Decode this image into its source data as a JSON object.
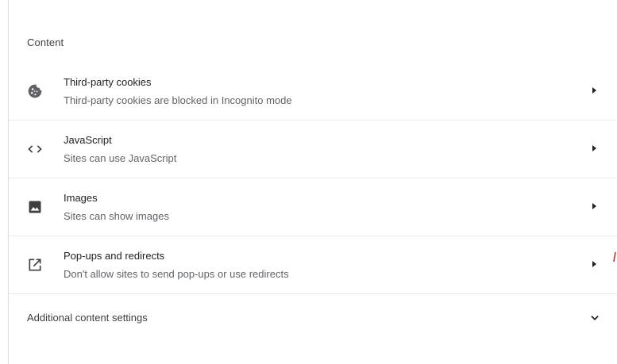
{
  "section": {
    "title": "Content"
  },
  "rows": [
    {
      "icon": "cookie-icon",
      "label": "Third-party cookies",
      "sublabel": "Third-party cookies are blocked in Incognito mode"
    },
    {
      "icon": "code-icon",
      "label": "JavaScript",
      "sublabel": "Sites can use JavaScript"
    },
    {
      "icon": "image-icon",
      "label": "Images",
      "sublabel": "Sites can show images"
    },
    {
      "icon": "open-in-new-icon",
      "label": "Pop-ups and redirects",
      "sublabel": "Don't allow sites to send pop-ups or use redirects"
    }
  ],
  "additional": {
    "label": "Additional content settings",
    "icon": "chevron-down-icon"
  },
  "colors": {
    "text": "#202124",
    "subtext": "#5f6368",
    "divider": "#e8eaed",
    "icon": "#5f6368"
  }
}
